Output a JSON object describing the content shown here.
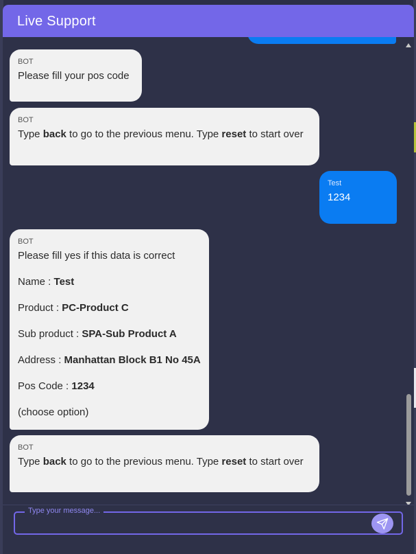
{
  "header": {
    "title": "Live Support"
  },
  "messages": [
    {
      "sender": "BOT",
      "text": "Please fill your pos code"
    },
    {
      "sender": "BOT",
      "parts": [
        "Type ",
        "back",
        " to go to the previous menu. Type ",
        "reset",
        " to start over"
      ]
    },
    {
      "sender": "Test",
      "text": "1234"
    },
    {
      "sender": "BOT",
      "text": "Please fill yes if this data is correct",
      "fields": [
        {
          "label": "Name : ",
          "value": "Test"
        },
        {
          "label": "Product : ",
          "value": "PC-Product C"
        },
        {
          "label": "Sub product : ",
          "value": "SPA-Sub Product A"
        },
        {
          "label": "Address : ",
          "value": "Manhattan Block B1 No 45A"
        },
        {
          "label": "Pos Code : ",
          "value": "1234"
        }
      ],
      "footer": "(choose option)"
    },
    {
      "sender": "BOT",
      "parts": [
        "Type ",
        "back",
        " to go to the previous menu. Type ",
        "reset",
        " to start over"
      ]
    }
  ],
  "input": {
    "placeholder": "Type your message...",
    "value": ""
  },
  "icons": {
    "send": "send-icon"
  },
  "colors": {
    "header": "#7367e8",
    "user_bubble": "#0a7cf2",
    "bot_bubble": "#f1f1f1",
    "background": "#2e3148"
  }
}
